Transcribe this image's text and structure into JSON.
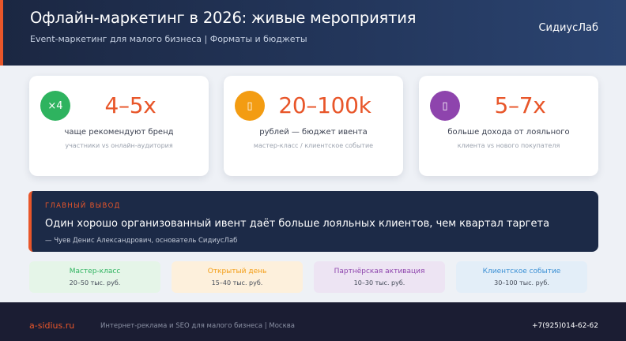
{
  "header": {
    "title": "Офлайн-маркетинг в 2026: живые мероприятия",
    "subtitle": "Event-маркетинг для малого бизнеса | Форматы и бюджеты",
    "brand": "СидиусЛаб"
  },
  "stats": [
    {
      "icon_text": "×4",
      "icon": "times-four-icon",
      "color": "#2eb35f",
      "value": "4–5x",
      "label": "чаще рекомендуют бренд",
      "sub": "участники vs онлайн-аудитория"
    },
    {
      "icon_text": "▯",
      "icon": "budget-icon",
      "color": "#f39c12",
      "value": "20–100k",
      "label": "рублей — бюджет ивента",
      "sub": "мастер-класс / клиентское событие"
    },
    {
      "icon_text": "▯",
      "icon": "loyalty-icon",
      "color": "#8e44ad",
      "value": "5–7x",
      "label": "больше дохода от лояльного",
      "sub": "клиента vs нового покупателя"
    }
  ],
  "verdict": {
    "kicker": "ГЛАВНЫЙ ВЫВОД",
    "quote": "Один хорошо организованный ивент даёт больше лояльных клиентов, чем квартал таргета",
    "author": "— Чуев Денис Александрович, основатель СидиусЛаб"
  },
  "formats": [
    {
      "name": "Мастер-класс",
      "price": "20–50 тыс. руб.",
      "bg": "#e5f5e8",
      "color": "#2eb35f"
    },
    {
      "name": "Открытый день",
      "price": "15–40 тыс. руб.",
      "bg": "#fdf0dc",
      "color": "#f39c12"
    },
    {
      "name": "Партнёрская активация",
      "price": "10–30 тыс. руб.",
      "bg": "#ede4f3",
      "color": "#8e44ad"
    },
    {
      "name": "Клиентское событие",
      "price": "30–100 тыс. руб.",
      "bg": "#e3eef8",
      "color": "#3a8fd4"
    }
  ],
  "footer": {
    "site": "a-sidius.ru",
    "desc": "Интернет-реклама и SEO для малого бизнеса | Москва",
    "phone": "+7(925)014-62-62"
  }
}
